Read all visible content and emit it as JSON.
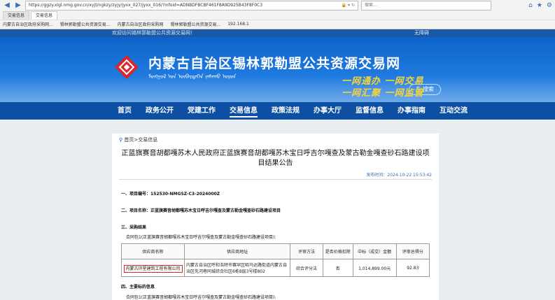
{
  "browser": {
    "url": "https://ggzy.xlgl.nmg.gov.cn/xyjt/ngkzy/zyjy/jyxx_027/jyxx_016/?infoid=ADNBDFBCBF461F8A9D925B43F8F0C3",
    "search_placeholder": "搜索...",
    "tabs": [
      "交易信息",
      "交易信息"
    ],
    "bookmarks": [
      "内蒙古自治区政府采购网...",
      "锡林郭勒盟公共资源交易...",
      "内蒙古自治区政府采购网",
      "锡林郭勒盟公共资源交易...",
      "192.168.1"
    ]
  },
  "site": {
    "welcome": "欢迎访问锡林郭勒盟公共资源交易网！",
    "date_text": "无障碍",
    "title": "内蒙古自治区锡林郭勒盟公共资源交易网",
    "mongolian": "ᠮᠣᠩᠭᠣᠯ ᠤᠨ ᠥᠪᠡᠷᠲᠡᠭᠡᠨ ᠵᠠᠰᠠᠬᠤ ᠣᠷᠤᠨ",
    "search_label": "搜索",
    "slogan_line1": "一网通办 一网交易",
    "slogan_line2": "一网汇聚 一网监管",
    "nav": [
      "首页",
      "政务公开",
      "党建工作",
      "交易信息",
      "政策法规",
      "办事大厅",
      "监督信息",
      "办事指南",
      "互动交流"
    ]
  },
  "article": {
    "breadcrumb_home": "首页",
    "breadcrumb_current": "交易信息",
    "title": "正蓝旗赛音胡都嘎苏木人民政府正蓝旗赛音胡都嘎苏木宝日呼吉尔嘎查及蒙古勒金嘎查砂石路建设项目结果公告",
    "publish_time": "发布时间：2024-10-22 15:53:42",
    "item1": "一、项目编号：152530-NMGSZ-C3-2024000Z",
    "item2": "二、项目名称：正蓝旗赛音胡都嘎苏木宝日呼吉尔嘎查及蒙古勒金嘎查砂石路建设项目",
    "item3": "三、采购结果",
    "package1": "合同包1(正蓝旗赛音胡都嘎苏木宝日呼吉尔嘎查及蒙古勒金嘎查砂石路建设项目):",
    "table": {
      "headers": [
        "供应商名称",
        "供应商地址",
        "评审方法",
        "是否价格扣除",
        "中标（成交）金额",
        "评审总得分"
      ],
      "rows": [
        [
          "内蒙古环星建筑工程有限公司",
          "内蒙古自治区呼和浩特市赛罕区昭乌达路街道内蒙古自治区先河巷同城综合社区6栋8层3号楼802",
          "综合评分法",
          "否",
          "1,014,899.00元",
          "92.83"
        ]
      ]
    },
    "item4": "四、主要标的信息",
    "package2": "合同包1(正蓝旗赛音胡都嘎苏木宝日呼吉尔嘎查及蒙古勒金嘎查砂石路建设项目):"
  }
}
